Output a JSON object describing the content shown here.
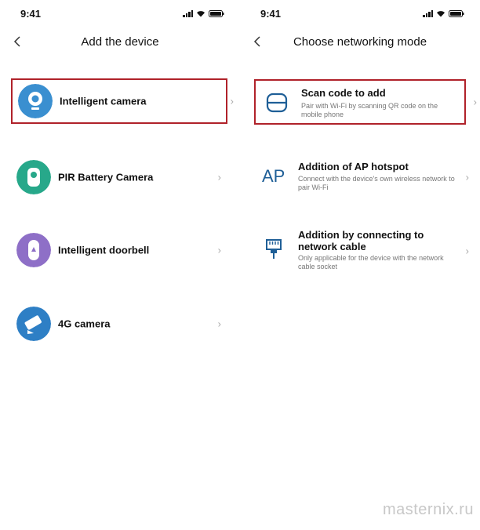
{
  "left": {
    "status": {
      "time": "9:41"
    },
    "title": "Add the device",
    "devices": [
      {
        "label": "Intelligent camera",
        "icon": "camera-icon",
        "color": "#3a8fd0"
      },
      {
        "label": "PIR Battery Camera",
        "icon": "battery-camera-icon",
        "color": "#27a88a"
      },
      {
        "label": "Intelligent doorbell",
        "icon": "doorbell-icon",
        "color": "#8e6fc7"
      },
      {
        "label": "4G camera",
        "icon": "4g-camera-icon",
        "color": "#2e7fc5"
      }
    ]
  },
  "right": {
    "status": {
      "time": "9:41"
    },
    "title": "Choose networking mode",
    "modes": [
      {
        "title": "Scan code to add",
        "desc": "Pair with Wi-Fi by scanning QR code on the mobile phone",
        "icon": "scan-icon"
      },
      {
        "title": "Addition of AP hotspot",
        "desc": "Connect with the device's own wireless network to pair Wi-Fi",
        "icon": "ap-icon",
        "icon_text": "AP"
      },
      {
        "title": "Addition by connecting to network cable",
        "desc": "Only applicable for the device with the network cable socket",
        "icon": "ethernet-icon"
      }
    ]
  },
  "chevron": "›",
  "highlight_color": "#b0222a",
  "accent_color": "#1f5f97",
  "watermark": "masternix.ru"
}
